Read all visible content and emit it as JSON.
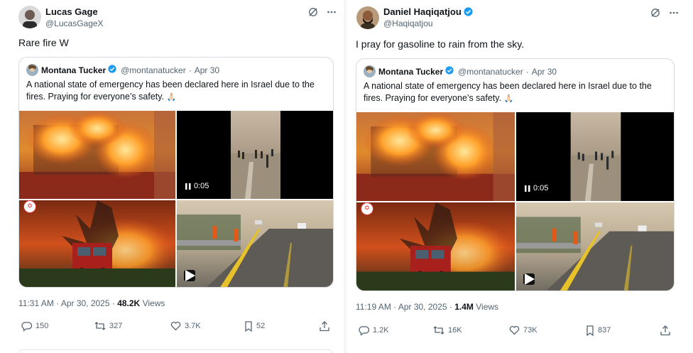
{
  "left": {
    "author": {
      "name": "Lucas Gage",
      "handle": "@LucasGageX"
    },
    "text": "Rare fire W",
    "quote": {
      "author": "Montana Tucker",
      "handle": "@montanatucker",
      "date": "Apr 30",
      "text": "A national state of emergency has been declared here in Israel due to the fires. Praying for everyone’s safety.",
      "emoji": "🙏🏻",
      "video_duration": "0:05"
    },
    "time": "11:31 AM · Apr 30, 2025 · ",
    "views_count": "48.2K",
    "views_label": "Views",
    "stats": {
      "replies": "150",
      "reposts": "327",
      "likes": "3.7K",
      "bookmarks": "52"
    }
  },
  "right": {
    "author": {
      "name": "Daniel Haqiqatjou",
      "handle": "@Haqiqatjou"
    },
    "text": "I pray for gasoline to rain from the sky.",
    "quote": {
      "author": "Montana Tucker",
      "handle": "@montanatucker",
      "date": "Apr 30",
      "text": "A national state of emergency has been declared here in Israel due to the fires. Praying for everyone’s safety.",
      "emoji": "🙏🏻",
      "video_duration": "0:05"
    },
    "time": "11:19 AM · Apr 30, 2025 · ",
    "views_count": "1.4M",
    "views_label": "Views",
    "stats": {
      "replies": "1.2K",
      "reposts": "16K",
      "likes": "73K",
      "bookmarks": "837"
    }
  },
  "colors": {
    "verified": "#1d9bf0",
    "text": "#0f1419",
    "muted": "#536471",
    "border": "#d6dbe0"
  },
  "icons": [
    "grok-icon",
    "more-icon",
    "verified-icon",
    "reply-icon",
    "repost-icon",
    "like-icon",
    "bookmark-icon",
    "share-icon",
    "pause-icon",
    "play-icon"
  ]
}
